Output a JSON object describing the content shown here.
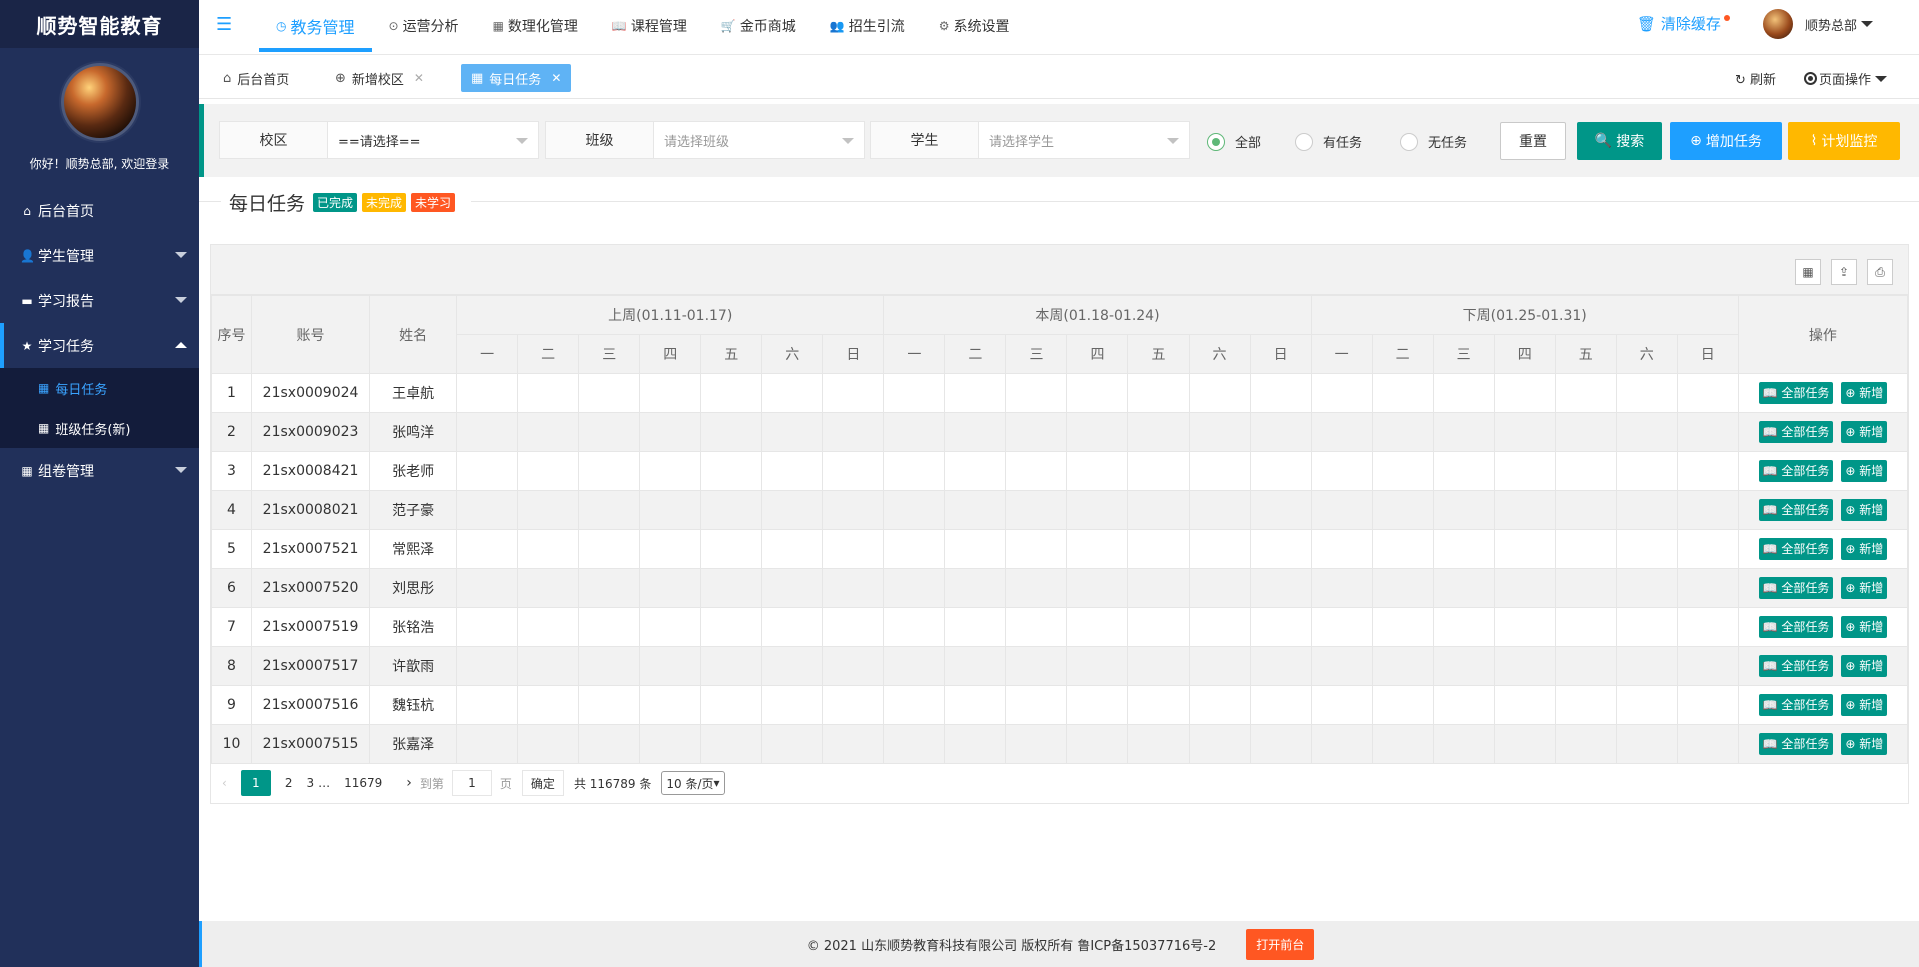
{
  "sidebar": {
    "brand": "顺势智能教育",
    "welcome": "你好！顺势总部, 欢迎登录",
    "items": [
      {
        "label": "后台首页"
      },
      {
        "label": "学生管理"
      },
      {
        "label": "学习报告"
      },
      {
        "label": "学习任务"
      },
      {
        "label": "组卷管理"
      }
    ],
    "sub_items": [
      {
        "label": "每日任务"
      },
      {
        "label": "班级任务(新)"
      }
    ]
  },
  "topbar": {
    "menu": [
      {
        "label": "教务管理"
      },
      {
        "label": "运营分析"
      },
      {
        "label": "数理化管理"
      },
      {
        "label": "课程管理"
      },
      {
        "label": "金币商城"
      },
      {
        "label": "招生引流"
      },
      {
        "label": "系统设置"
      }
    ],
    "clear_cache": "清除缓存",
    "user_name": "顺势总部"
  },
  "tabs": {
    "items": [
      {
        "label": "后台首页"
      },
      {
        "label": "新增校区"
      },
      {
        "label": "每日任务"
      }
    ],
    "refresh": "刷新",
    "page_ops": "页面操作"
  },
  "filters": {
    "campus_label": "校区",
    "campus_value": "==请选择==",
    "class_label": "班级",
    "class_placeholder": "请选择班级",
    "student_label": "学生",
    "student_placeholder": "请选择学生",
    "radios": [
      {
        "label": "全部",
        "checked": true
      },
      {
        "label": "有任务",
        "checked": false
      },
      {
        "label": "无任务",
        "checked": false
      }
    ],
    "reset": "重置",
    "search": "搜索",
    "add_task": "增加任务",
    "plan_monitor": "计划监控"
  },
  "section": {
    "title": "每日任务",
    "badges": [
      {
        "label": "已完成",
        "color": "#009688"
      },
      {
        "label": "未完成",
        "color": "#ffb800"
      },
      {
        "label": "未学习",
        "color": "#ff5722"
      }
    ]
  },
  "table": {
    "col_index": "序号",
    "col_account": "账号",
    "col_name": "姓名",
    "col_ops": "操作",
    "weeks": [
      "上周(01.11-01.17)",
      "本周(01.18-01.24)",
      "下周(01.25-01.31)"
    ],
    "days": [
      "一",
      "二",
      "三",
      "四",
      "五",
      "六",
      "日"
    ],
    "op_all": "全部任务",
    "op_add": "新增",
    "rows": [
      {
        "idx": "1",
        "account": "21sx0009024",
        "name": "王卓航"
      },
      {
        "idx": "2",
        "account": "21sx0009023",
        "name": "张鸣洋"
      },
      {
        "idx": "3",
        "account": "21sx0008421",
        "name": "张老师"
      },
      {
        "idx": "4",
        "account": "21sx0008021",
        "name": "范子豪"
      },
      {
        "idx": "5",
        "account": "21sx0007521",
        "name": "常熙泽"
      },
      {
        "idx": "6",
        "account": "21sx0007520",
        "name": "刘思彤"
      },
      {
        "idx": "7",
        "account": "21sx0007519",
        "name": "张铭浩"
      },
      {
        "idx": "8",
        "account": "21sx0007517",
        "name": "许歆雨"
      },
      {
        "idx": "9",
        "account": "21sx0007516",
        "name": "魏钰杭"
      },
      {
        "idx": "10",
        "account": "21sx0007515",
        "name": "张嘉泽"
      }
    ]
  },
  "pager": {
    "current": "1",
    "p2": "2",
    "p3": "3",
    "ellipsis": "…",
    "last": "11679",
    "goto": "到第",
    "goto_value": "1",
    "page_unit": "页",
    "confirm": "确定",
    "total": "共 116789 条",
    "per_page": "10 条/页"
  },
  "footer": {
    "copyright": "© 2021 山东顺势教育科技有限公司 版权所有 鲁ICP备15037716号-2",
    "open_front": "打开前台"
  }
}
